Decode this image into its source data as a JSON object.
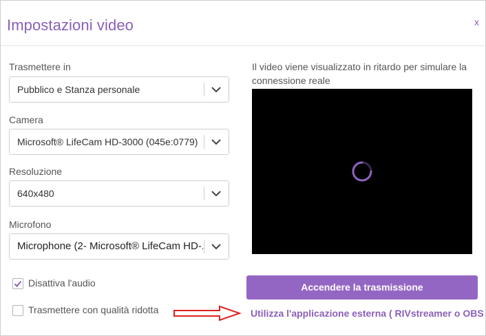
{
  "dialog": {
    "title": "Impostazioni video",
    "close_label": "x"
  },
  "form": {
    "broadcast": {
      "label": "Trasmettere in",
      "selected": "Pubblico e Stanza personale"
    },
    "camera": {
      "label": "Camera",
      "selected": "Microsoft® LifeCam HD-3000 (045e:0779)"
    },
    "resolution": {
      "label": "Resoluzione",
      "selected": "640x480"
    },
    "microphone": {
      "label": "Microfono",
      "selected": "Microphone  (2- Microsoft® LifeCam HD-..."
    },
    "mute_audio": {
      "label": "Disattiva l'audio",
      "checked": true
    },
    "low_quality": {
      "label": "Trasmettere con qualità ridotta",
      "checked": false
    }
  },
  "preview": {
    "note": "Il video viene visualizzato in ritardo per simulare la connessione reale"
  },
  "actions": {
    "start_button": "Accendere la trasmissione",
    "external_link": "Utilizza l'applicazione esterna ( RIVstreamer o OBS )"
  },
  "colors": {
    "accent": "#9466c4",
    "title": "#8b5fb8",
    "annotation_arrow": "#e02020"
  },
  "icons": {
    "chevron": "chevron-down-icon",
    "spinner": "loading-spinner-icon",
    "check": "checkmark-icon",
    "arrow": "right-arrow-annotation-icon"
  }
}
